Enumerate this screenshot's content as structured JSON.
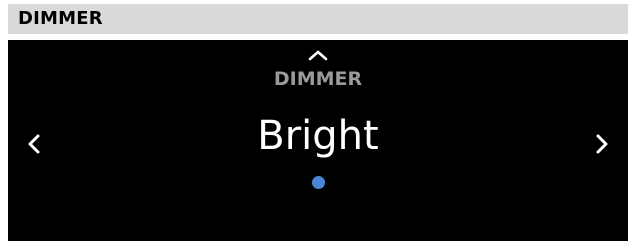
{
  "header": {
    "title": "DIMMER"
  },
  "screen": {
    "menu_label": "DIMMER",
    "value": "Bright",
    "page_count": 1,
    "active_page": 1
  },
  "icons": {
    "up": "chevron-up-icon",
    "left": "chevron-left-icon",
    "right": "chevron-right-icon"
  },
  "colors": {
    "header_bg": "#d9d9d9",
    "screen_bg": "#000000",
    "label": "#9a9a9a",
    "value": "#ffffff",
    "accent_dot": "#4a86d8"
  }
}
